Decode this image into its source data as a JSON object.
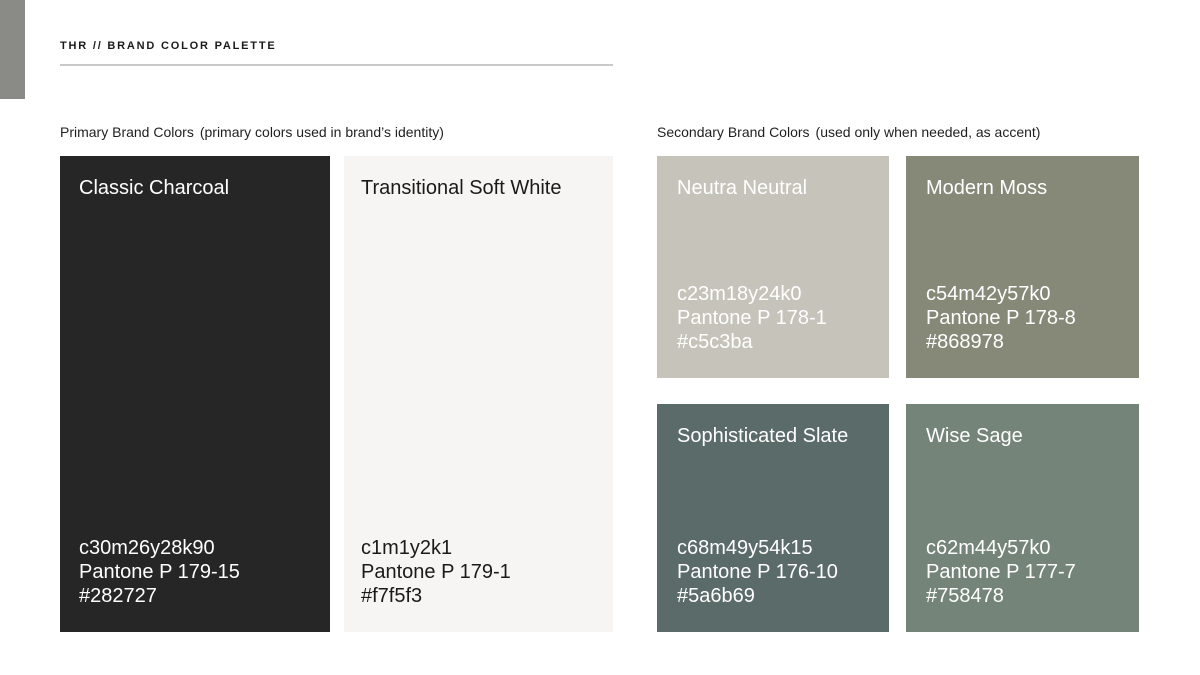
{
  "header": {
    "title": "THR // BRAND COLOR PALETTE"
  },
  "primary": {
    "label": "Primary Brand Colors",
    "note": "(primary colors used in brand’s identity)",
    "swatches": [
      {
        "name": "Classic Charcoal",
        "cmyk": "c30m26y28k90",
        "pantone": "Pantone P 179-15",
        "hex": "#282727",
        "color": "#262626"
      },
      {
        "name": "Transitional Soft White",
        "cmyk": "c1m1y2k1",
        "pantone": "Pantone P 179-1",
        "hex": "#f7f5f3",
        "color": "#f7f5f3"
      }
    ]
  },
  "secondary": {
    "label": "Secondary Brand Colors",
    "note": "(used only when needed, as accent)",
    "swatches": [
      {
        "name": "Neutra Neutral",
        "cmyk": "c23m18y24k0",
        "pantone": "Pantone P 178-1",
        "hex": "#c5c3ba",
        "color": "#c5c3ba"
      },
      {
        "name": "Modern Moss",
        "cmyk": "c54m42y57k0",
        "pantone": "Pantone P 178-8",
        "hex": "#868978",
        "color": "#868978"
      },
      {
        "name": "Sophisticated Slate",
        "cmyk": "c68m49y54k15",
        "pantone": "Pantone P 176-10",
        "hex": "#5a6b69",
        "color": "#5a6b69"
      },
      {
        "name": "Wise Sage",
        "cmyk": "c62m44y57k0",
        "pantone": "Pantone P 177-7",
        "hex": "#758478",
        "color": "#758478"
      }
    ]
  }
}
